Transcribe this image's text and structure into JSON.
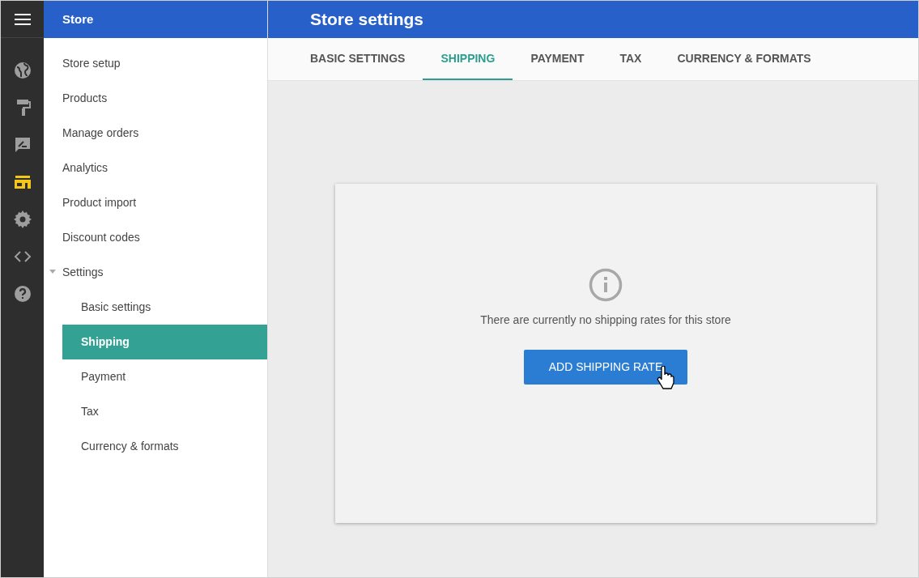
{
  "rail": {
    "items": [
      {
        "selected": false
      },
      {
        "selected": false
      },
      {
        "selected": false
      },
      {
        "selected": true
      },
      {
        "selected": false
      },
      {
        "selected": false
      },
      {
        "selected": false
      }
    ]
  },
  "sidebar": {
    "title": "Store",
    "items": [
      {
        "label": "Store setup",
        "selected": false
      },
      {
        "label": "Products",
        "selected": false
      },
      {
        "label": "Manage orders",
        "selected": false
      },
      {
        "label": "Analytics",
        "selected": false
      },
      {
        "label": "Product import",
        "selected": false
      },
      {
        "label": "Discount codes",
        "selected": false
      },
      {
        "label": "Settings",
        "selected": false,
        "expanded": true,
        "children": [
          {
            "label": "Basic settings",
            "selected": false
          },
          {
            "label": "Shipping",
            "selected": true
          },
          {
            "label": "Payment",
            "selected": false
          },
          {
            "label": "Tax",
            "selected": false
          },
          {
            "label": "Currency & formats",
            "selected": false
          }
        ]
      }
    ]
  },
  "header": {
    "title": "Store settings"
  },
  "tabs": [
    {
      "label": "BASIC SETTINGS",
      "selected": false
    },
    {
      "label": "SHIPPING",
      "selected": true
    },
    {
      "label": "PAYMENT",
      "selected": false
    },
    {
      "label": "TAX",
      "selected": false
    },
    {
      "label": "CURRENCY & FORMATS",
      "selected": false
    }
  ],
  "empty_state": {
    "message": "There are currently no shipping rates for this store",
    "button": "ADD SHIPPING RATE"
  }
}
